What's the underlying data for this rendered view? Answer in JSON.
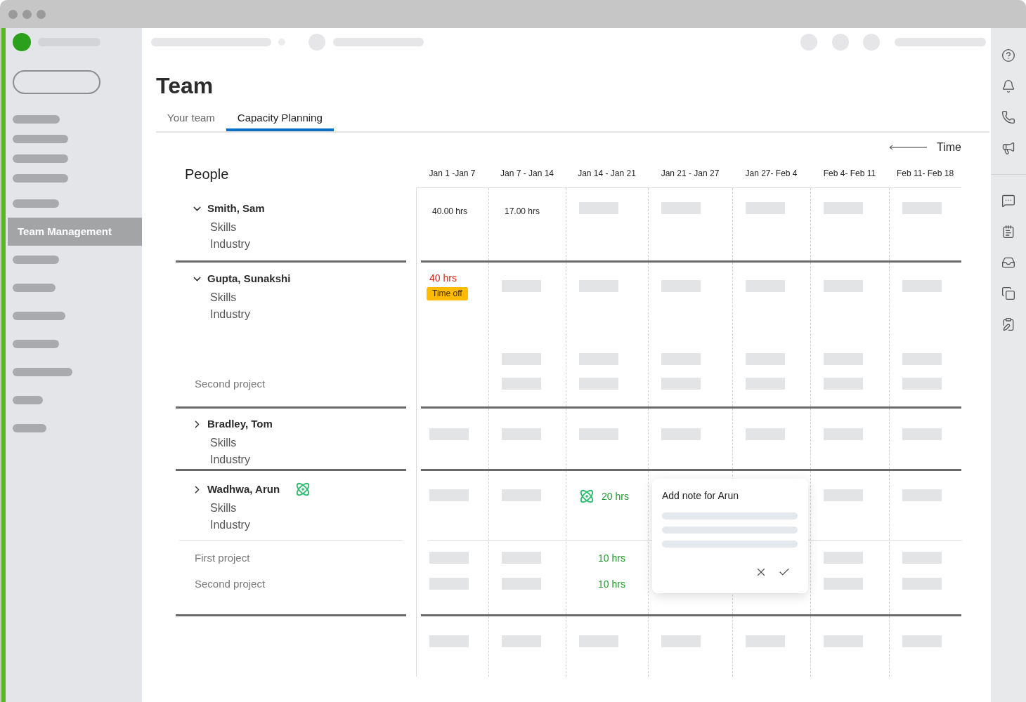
{
  "sidebar": {
    "items": [
      {
        "kind": "skeleton",
        "selected": false
      },
      {
        "kind": "skeleton",
        "selected": false
      },
      {
        "kind": "skeleton",
        "selected": false
      },
      {
        "kind": "skeleton",
        "selected": false
      },
      {
        "kind": "skeleton",
        "selected": false
      },
      {
        "kind": "label",
        "label": "Team Management",
        "selected": true
      },
      {
        "kind": "skeleton",
        "selected": false
      },
      {
        "kind": "skeleton",
        "selected": false
      },
      {
        "kind": "skeleton",
        "selected": false
      },
      {
        "kind": "skeleton",
        "selected": false
      },
      {
        "kind": "skeleton",
        "selected": false
      },
      {
        "kind": "skeleton",
        "selected": false
      },
      {
        "kind": "skeleton",
        "selected": false
      }
    ]
  },
  "page": {
    "title": "Team"
  },
  "tabs": [
    {
      "label": "Your team",
      "selected": false
    },
    {
      "label": "Capacity Planning",
      "selected": true
    }
  ],
  "timeline": {
    "label": "Time"
  },
  "people_panel": {
    "heading": "People"
  },
  "columns": [
    "Jan 1 -Jan 7",
    "Jan 7 - Jan 14",
    "Jan 14 - Jan 21",
    "Jan 21 - Jan 27",
    "Jan 27- Feb 4",
    "Feb 4- Feb 11",
    "Feb 11- Feb 18"
  ],
  "people": [
    {
      "name": "Smith, Sam",
      "expanded": true,
      "flagged": false,
      "details": [
        "Skills",
        "Industry"
      ],
      "cells": [
        {
          "kind": "hours",
          "text": "40.00 hrs"
        },
        {
          "kind": "hours",
          "text": "17.00 hrs"
        },
        {
          "kind": "skeleton"
        },
        {
          "kind": "skeleton"
        },
        {
          "kind": "skeleton"
        },
        {
          "kind": "skeleton"
        },
        {
          "kind": "skeleton"
        }
      ]
    },
    {
      "name": "Gupta, Sunakshi",
      "expanded": true,
      "flagged": false,
      "details": [
        "Skills",
        "Industry"
      ],
      "cells": [
        {
          "kind": "over",
          "text": "40 hrs",
          "badge": "Time off"
        },
        {
          "kind": "skeleton"
        },
        {
          "kind": "skeleton"
        },
        {
          "kind": "skeleton"
        },
        {
          "kind": "skeleton"
        },
        {
          "kind": "skeleton"
        },
        {
          "kind": "skeleton"
        }
      ],
      "projects": [
        {
          "cells": [
            {
              "kind": "empty"
            },
            {
              "kind": "skeleton"
            },
            {
              "kind": "skeleton"
            },
            {
              "kind": "skeleton"
            },
            {
              "kind": "skeleton"
            },
            {
              "kind": "skeleton"
            },
            {
              "kind": "skeleton"
            }
          ]
        },
        {
          "label": "Second project",
          "cells": [
            {
              "kind": "empty"
            },
            {
              "kind": "skeleton"
            },
            {
              "kind": "skeleton"
            },
            {
              "kind": "skeleton"
            },
            {
              "kind": "skeleton"
            },
            {
              "kind": "skeleton"
            },
            {
              "kind": "skeleton"
            }
          ]
        }
      ]
    },
    {
      "name": "Bradley, Tom",
      "expanded": false,
      "flagged": false,
      "details": [
        "Skills",
        "Industry"
      ],
      "cells": [
        {
          "kind": "skeleton"
        },
        {
          "kind": "skeleton"
        },
        {
          "kind": "skeleton"
        },
        {
          "kind": "skeleton"
        },
        {
          "kind": "skeleton"
        },
        {
          "kind": "skeleton"
        },
        {
          "kind": "skeleton"
        }
      ]
    },
    {
      "name": "Wadhwa, Arun",
      "expanded": false,
      "flagged": true,
      "details": [
        "Skills",
        "Industry"
      ],
      "cells": [
        {
          "kind": "skeleton"
        },
        {
          "kind": "skeleton"
        },
        {
          "kind": "flagged",
          "text": "20 hrs"
        },
        {
          "kind": "empty"
        },
        {
          "kind": "empty"
        },
        {
          "kind": "skeleton"
        },
        {
          "kind": "skeleton"
        }
      ],
      "projects": [
        {
          "label": "First project",
          "cells": [
            {
              "kind": "skeleton"
            },
            {
              "kind": "skeleton"
            },
            {
              "kind": "planned",
              "text": "10 hrs"
            },
            {
              "kind": "empty"
            },
            {
              "kind": "empty"
            },
            {
              "kind": "skeleton"
            },
            {
              "kind": "skeleton"
            }
          ]
        },
        {
          "label": "Second project",
          "cells": [
            {
              "kind": "skeleton"
            },
            {
              "kind": "skeleton"
            },
            {
              "kind": "planned",
              "text": "10 hrs"
            },
            {
              "kind": "empty"
            },
            {
              "kind": "empty"
            },
            {
              "kind": "skeleton"
            },
            {
              "kind": "skeleton"
            }
          ]
        }
      ]
    }
  ],
  "rows_below": [
    {
      "cells": [
        {
          "kind": "skeleton"
        },
        {
          "kind": "skeleton"
        },
        {
          "kind": "skeleton"
        },
        {
          "kind": "skeleton"
        },
        {
          "kind": "skeleton"
        },
        {
          "kind": "skeleton"
        },
        {
          "kind": "skeleton"
        }
      ]
    }
  ],
  "note_popover": {
    "title": "Add note for Arun"
  }
}
